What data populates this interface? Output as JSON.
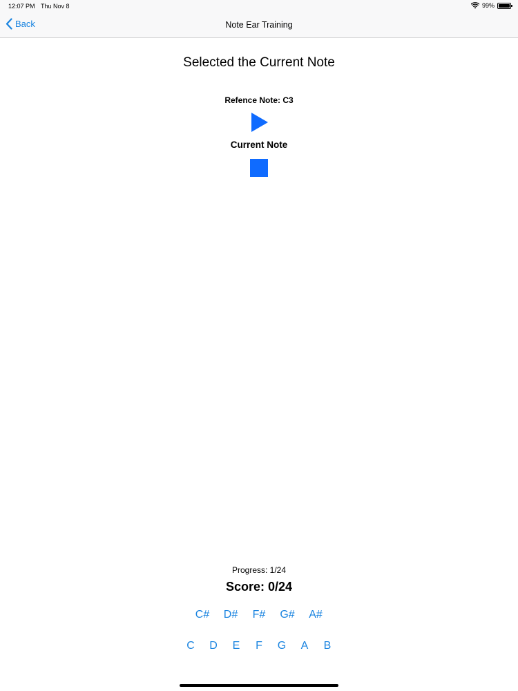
{
  "status_bar": {
    "time": "12:07 PM",
    "date": "Thu Nov 8",
    "battery_pct": "99%",
    "battery_level": 0.99,
    "wifi_icon": "wifi-icon",
    "battery_icon": "battery-icon"
  },
  "nav": {
    "back_label": "Back",
    "back_icon": "chevron-left-icon",
    "title": "Note Ear Training",
    "accent_color": "#1a84e0"
  },
  "main": {
    "title": "Selected the Current Note",
    "reference_label": "Refence Note: C3",
    "play_icon": "play-icon",
    "current_label": "Current Note",
    "stop_icon": "stop-icon",
    "control_color": "#0f6bff"
  },
  "footer": {
    "progress": "Progress: 1/24",
    "score": "Score: 0/24"
  },
  "notes": {
    "sharps": [
      "C#",
      "D#",
      "F#",
      "G#",
      "A#"
    ],
    "naturals": [
      "C",
      "D",
      "E",
      "F",
      "G",
      "A",
      "B"
    ]
  }
}
